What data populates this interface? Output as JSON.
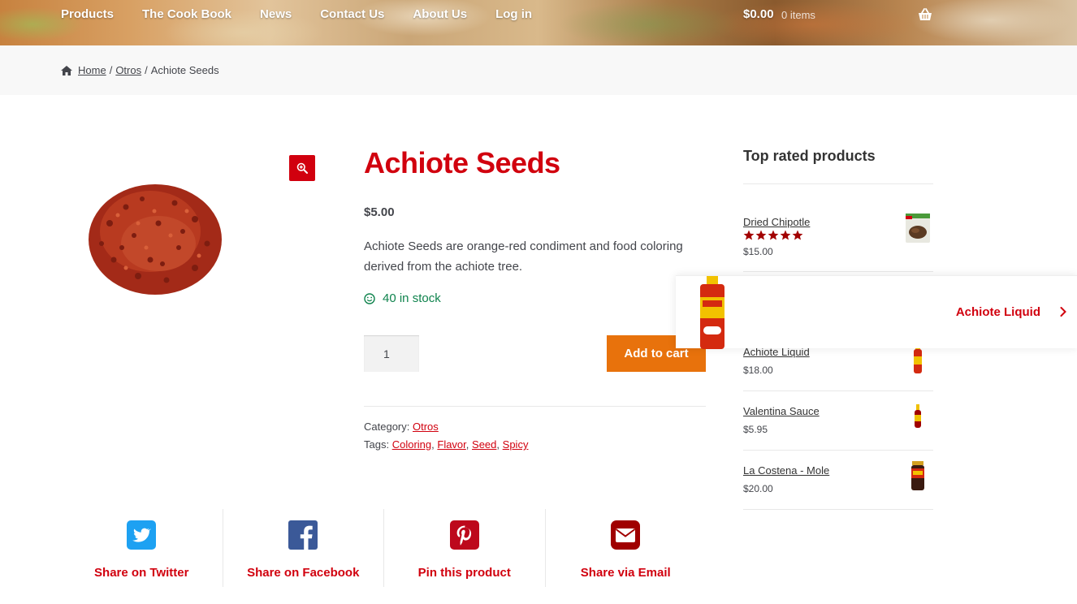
{
  "header": {
    "nav": [
      "Products",
      "The Cook Book",
      "News",
      "Contact Us",
      "About Us",
      "Log in"
    ],
    "cart_total": "$0.00",
    "cart_count": "0 items"
  },
  "breadcrumb": {
    "home": "Home",
    "category": "Otros",
    "separator": "/",
    "current": "Achiote Seeds"
  },
  "product": {
    "title": "Achiote Seeds",
    "price": "$5.00",
    "description": "Achiote Seeds are orange-red condiment and food coloring derived from the achiote tree.",
    "stock": "40 in stock",
    "quantity": "1",
    "add_to_cart_label": "Add to cart",
    "category_label": "Category:",
    "category": "Otros",
    "tags_label": "Tags:",
    "tags": [
      "Coloring",
      "Flavor",
      "Seed",
      "Spicy"
    ],
    "comma": ","
  },
  "share": {
    "twitter": "Share on Twitter",
    "facebook": "Share on Facebook",
    "pinterest": "Pin this product",
    "email": "Share via Email"
  },
  "sidebar": {
    "title": "Top rated products",
    "products": [
      {
        "name": "Dried Chipotle",
        "price": "$15.00",
        "rating": 5
      },
      {
        "name": "Achiote Liquid",
        "price": "$18.00"
      },
      {
        "name": "Valentina Sauce",
        "price": "$5.95"
      },
      {
        "name": "La Costena - Mole",
        "price": "$20.00"
      }
    ]
  },
  "next_product": {
    "name": "Achiote Liquid"
  },
  "colors": {
    "accent_red": "#d1000e",
    "button_orange": "#e8720c",
    "stock_green": "#0f834d",
    "share_twitter": "#1da1f2",
    "share_facebook": "#3b5998",
    "share_pinterest": "#bd081c",
    "share_email": "#a00000"
  }
}
